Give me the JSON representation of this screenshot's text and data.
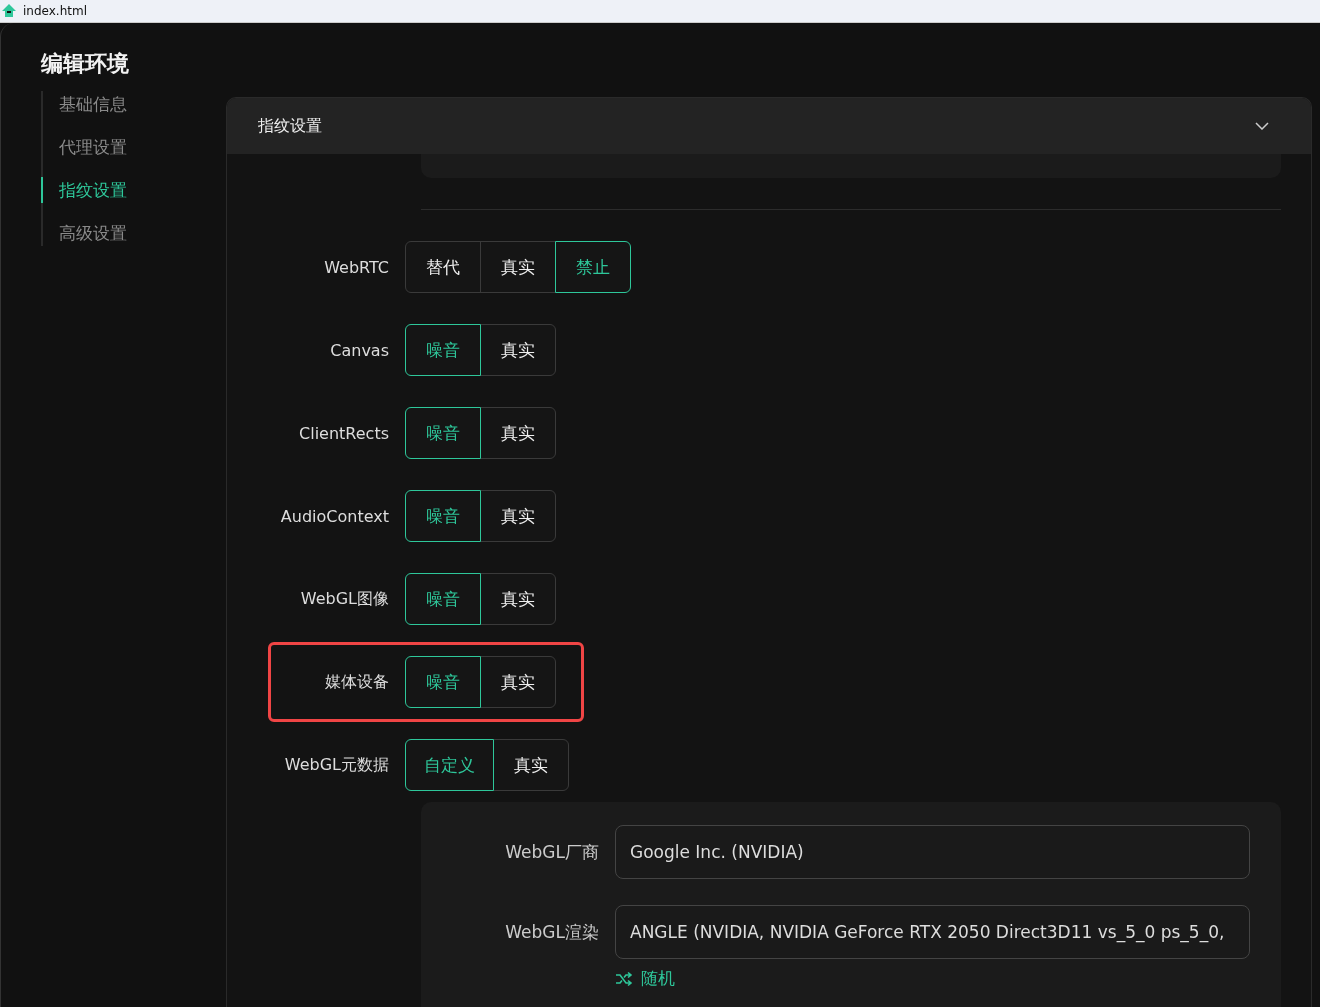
{
  "browser_tab": {
    "title": "index.html"
  },
  "sidebar": {
    "title": "编辑环境",
    "items": [
      {
        "label": "基础信息",
        "selected": false
      },
      {
        "label": "代理设置",
        "selected": false
      },
      {
        "label": "指纹设置",
        "selected": true
      },
      {
        "label": "高级设置",
        "selected": false
      }
    ]
  },
  "panel": {
    "title": "指纹设置",
    "expanded": true,
    "settings": [
      {
        "label": "WebRTC",
        "highlighted": false,
        "options": [
          {
            "label": "替代",
            "selected": false
          },
          {
            "label": "真实",
            "selected": false
          },
          {
            "label": "禁止",
            "selected": true
          }
        ]
      },
      {
        "label": "Canvas",
        "highlighted": false,
        "options": [
          {
            "label": "噪音",
            "selected": true
          },
          {
            "label": "真实",
            "selected": false
          }
        ]
      },
      {
        "label": "ClientRects",
        "highlighted": false,
        "options": [
          {
            "label": "噪音",
            "selected": true
          },
          {
            "label": "真实",
            "selected": false
          }
        ]
      },
      {
        "label": "AudioContext",
        "highlighted": false,
        "options": [
          {
            "label": "噪音",
            "selected": true
          },
          {
            "label": "真实",
            "selected": false
          }
        ]
      },
      {
        "label": "WebGL图像",
        "highlighted": false,
        "options": [
          {
            "label": "噪音",
            "selected": true
          },
          {
            "label": "真实",
            "selected": false
          }
        ]
      },
      {
        "label": "媒体设备",
        "highlighted": true,
        "options": [
          {
            "label": "噪音",
            "selected": true
          },
          {
            "label": "真实",
            "selected": false
          }
        ]
      },
      {
        "label": "WebGL元数据",
        "highlighted": false,
        "options": [
          {
            "label": "自定义",
            "selected": true
          },
          {
            "label": "真实",
            "selected": false
          }
        ]
      }
    ],
    "webgl_fields": [
      {
        "label": "WebGL厂商",
        "value": "Google Inc. (NVIDIA)"
      },
      {
        "label": "WebGL渲染",
        "value": "ANGLE (NVIDIA, NVIDIA GeForce RTX 2050 Direct3D11 vs_5_0 ps_5_0,"
      }
    ],
    "random_button": "随机"
  }
}
